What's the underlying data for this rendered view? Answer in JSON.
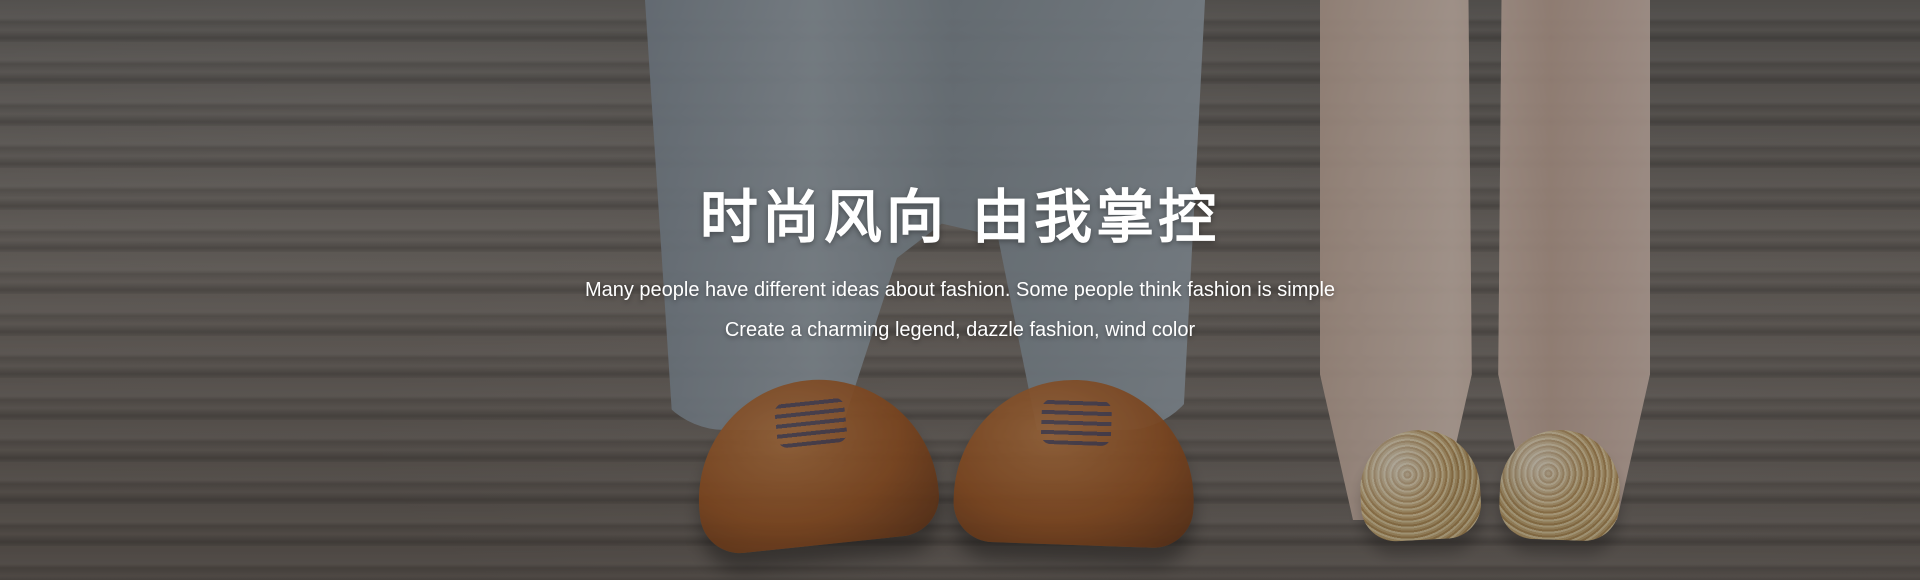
{
  "banner": {
    "title": "时尚风向 由我掌控",
    "line1": "Many people have different ideas about fashion. Some people think fashion is simple",
    "line2": "Create a charming legend, dazzle fashion, wind color"
  },
  "colors": {
    "text": "#ffffff",
    "overlay": "rgba(0,0,0,0.28)"
  }
}
